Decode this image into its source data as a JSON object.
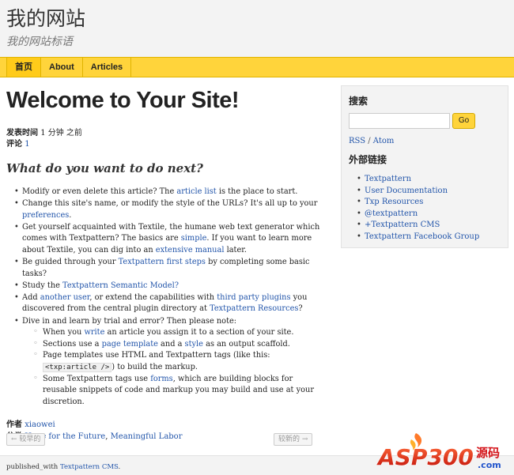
{
  "header": {
    "site_title": "我的网站",
    "site_slogan": "我的网站标语"
  },
  "nav": {
    "items": [
      "首页",
      "About",
      "Articles"
    ]
  },
  "article": {
    "title": "Welcome to Your Site!",
    "meta": {
      "posted_label": "发表时间",
      "posted_value": "1 分钟 之前",
      "comments_label": "评论",
      "comments_value": "1"
    },
    "subheading": "What do you want to do next?",
    "items": {
      "i1_a": "Modify or even delete this article? The ",
      "i1_link": "article list",
      "i1_b": " is the place to start.",
      "i2_a": "Change this site's name, or modify the style of the URLs? It's all up to your ",
      "i2_link": "preferences",
      "i2_b": ".",
      "i3_a": "Get yourself acquainted with Textile, the humane web text generator which comes with Textpattern? The basics are ",
      "i3_link1": "simple",
      "i3_b": ". If you want to learn more about Textile, you can dig into an ",
      "i3_link2": "extensive manual",
      "i3_c": " later.",
      "i4_a": "Be guided through your ",
      "i4_link": "Textpattern first steps",
      "i4_b": " by completing some basic tasks?",
      "i5_a": "Study the ",
      "i5_link": "Textpattern Semantic Model?",
      "i6_a": "Add ",
      "i6_link1": "another user",
      "i6_b": ", or extend the capabilities with ",
      "i6_link2": "third party plugins",
      "i6_c": " you discovered from the central plugin directory at ",
      "i6_link3": "Textpattern Resources",
      "i6_d": "?",
      "i7": "Dive in and learn by trial and error? Then please note:",
      "s1_a": "When you ",
      "s1_link": "write",
      "s1_b": " an article you assign it to a section of your site.",
      "s2_a": "Sections use a ",
      "s2_link1": "page template",
      "s2_b": " and a ",
      "s2_link2": "style",
      "s2_c": " as an output scaffold.",
      "s3_a": "Page templates use HTML and Textpattern tags (like this: ",
      "s3_code": "<txp:article />",
      "s3_b": ") to build the markup.",
      "s4_a": "Some Textpattern tags use ",
      "s4_link": "forms",
      "s4_b": ", which are building blocks for reusable snippets of code and markup you may build and use at your discretion."
    },
    "footer": {
      "author_label": "作者",
      "author_value": "xiaowei",
      "category_label": "分类",
      "category_1": "Hope for the Future",
      "category_sep": ", ",
      "category_2": "Meaningful Labor"
    },
    "pager": {
      "prev": "← 较早的",
      "next": "较新的 →"
    }
  },
  "sidebar": {
    "search_heading": "搜索",
    "search_value": "",
    "go_label": "Go",
    "rss": "RSS",
    "feed_sep": " / ",
    "atom": "Atom",
    "links_heading": "外部链接",
    "links": [
      "Textpattern",
      "User Documentation",
      "Txp Resources",
      "@textpattern",
      "+Textpattern CMS",
      "Textpattern Facebook Group"
    ]
  },
  "footer": {
    "text": "published_with ",
    "link": "Textpattern CMS",
    "end": "."
  },
  "watermark": {
    "brand": "ASP300",
    "cn": "源码",
    "domain": ".com"
  },
  "colors": {
    "nav_bg": "#ffd43b",
    "link": "#2255aa"
  }
}
